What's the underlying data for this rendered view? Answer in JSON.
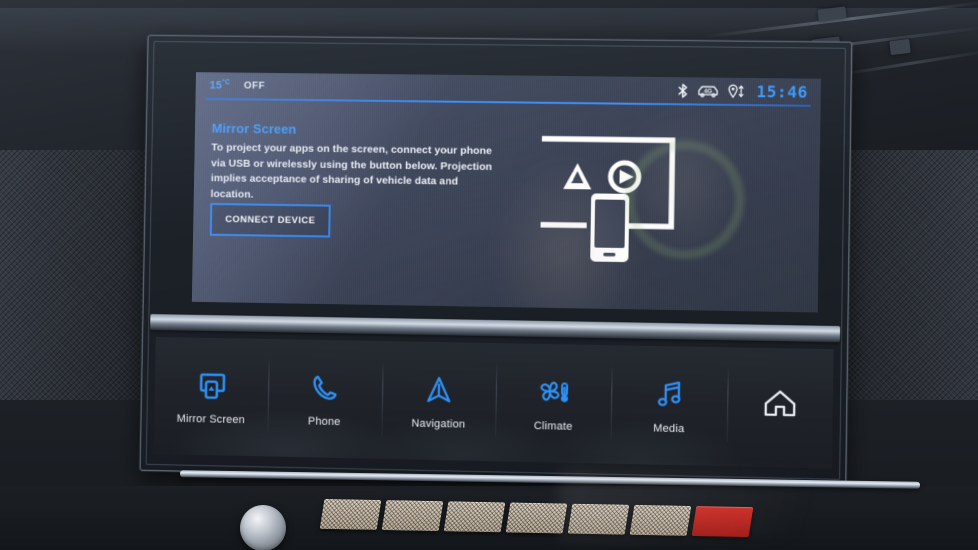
{
  "status_bar": {
    "temperature": "15",
    "temperature_unit": "°C",
    "climate_state": "OFF",
    "icons": [
      {
        "name": "bluetooth-icon",
        "label": "Bluetooth"
      },
      {
        "name": "car-4g-icon",
        "label": "4G"
      },
      {
        "name": "location-share-icon",
        "label": "Location"
      }
    ],
    "time": "15:46"
  },
  "main": {
    "title": "Mirror Screen",
    "description": "To project your apps on the screen, connect your phone via USB or wirelessly using the button below. Projection implies acceptance of sharing of vehicle data and location.",
    "connect_button_label": "CONNECT DEVICE",
    "hero_icons": [
      {
        "name": "android-auto-triangle-icon"
      },
      {
        "name": "carplay-play-circle-icon"
      },
      {
        "name": "smartphone-icon"
      },
      {
        "name": "display-frame-icon"
      }
    ]
  },
  "nav_bar": {
    "items": [
      {
        "label": "Mirror Screen",
        "icon": "screen-cast-icon",
        "active": true
      },
      {
        "label": "Phone",
        "icon": "phone-handset-icon",
        "active": false
      },
      {
        "label": "Navigation",
        "icon": "navigation-arrow-icon",
        "active": false
      },
      {
        "label": "Climate",
        "icon": "fan-thermometer-icon",
        "active": false
      },
      {
        "label": "Media",
        "icon": "music-note-icon",
        "active": false
      },
      {
        "label": "",
        "icon": "home-icon",
        "active": false
      }
    ]
  },
  "colors": {
    "accent_blue": "#3d9bff",
    "button_border": "#2f86f0",
    "text_primary": "#f0f3f8",
    "screen_bg": "#3c4457",
    "navbar_bg": "#20242a"
  }
}
